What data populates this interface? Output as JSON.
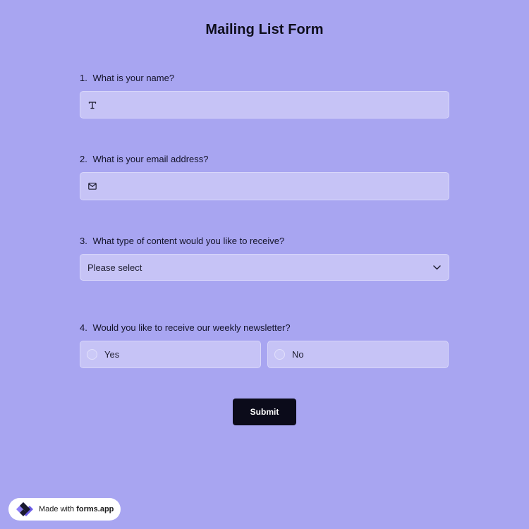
{
  "form": {
    "title": "Mailing List Form"
  },
  "questions": [
    {
      "number": "1.",
      "label": "What is your name?",
      "value": "",
      "placeholder": "",
      "icon": "text-icon"
    },
    {
      "number": "2.",
      "label": "What is your email address?",
      "value": "",
      "placeholder": "",
      "icon": "mail-icon"
    },
    {
      "number": "3.",
      "label": "What type of content would you like to receive?",
      "selected": "Please select",
      "icon": "chevron-down-icon"
    },
    {
      "number": "4.",
      "label": "Would you like to receive our weekly newsletter?",
      "options": [
        "Yes",
        "No"
      ]
    }
  ],
  "submit": {
    "label": "Submit"
  },
  "badge": {
    "prefix": "Made with",
    "brand": "forms.app"
  },
  "colors": {
    "background": "#a8a5f1",
    "field": "#c6c3f6",
    "button": "#0b0b1a",
    "brand_purple": "#8b7cf6"
  }
}
